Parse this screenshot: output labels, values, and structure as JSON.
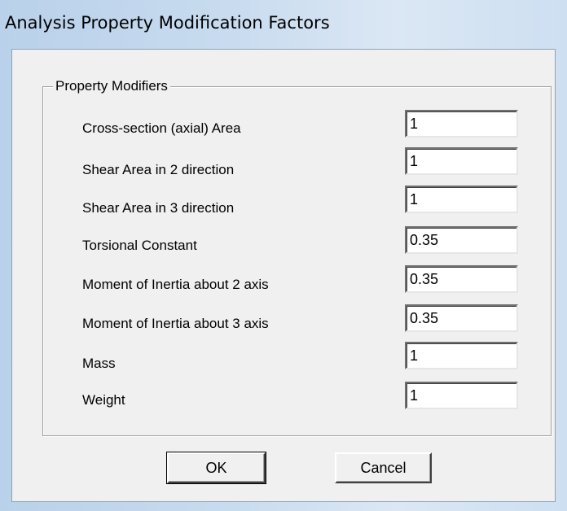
{
  "window": {
    "title": "Analysis Property Modification Factors"
  },
  "group": {
    "legend": "Property Modifiers"
  },
  "fields": [
    {
      "label": "Cross-section (axial) Area",
      "value": "1"
    },
    {
      "label": "Shear Area in 2 direction",
      "value": "1"
    },
    {
      "label": "Shear Area in 3 direction",
      "value": "1"
    },
    {
      "label": "Torsional Constant",
      "value": "0.35"
    },
    {
      "label": "Moment of Inertia about 2 axis",
      "value": "0.35"
    },
    {
      "label": "Moment of Inertia about 3 axis",
      "value": "0.35"
    },
    {
      "label": "Mass",
      "value": "1"
    },
    {
      "label": "Weight",
      "value": "1"
    }
  ],
  "buttons": {
    "ok_label": "OK",
    "cancel_label": "Cancel"
  }
}
